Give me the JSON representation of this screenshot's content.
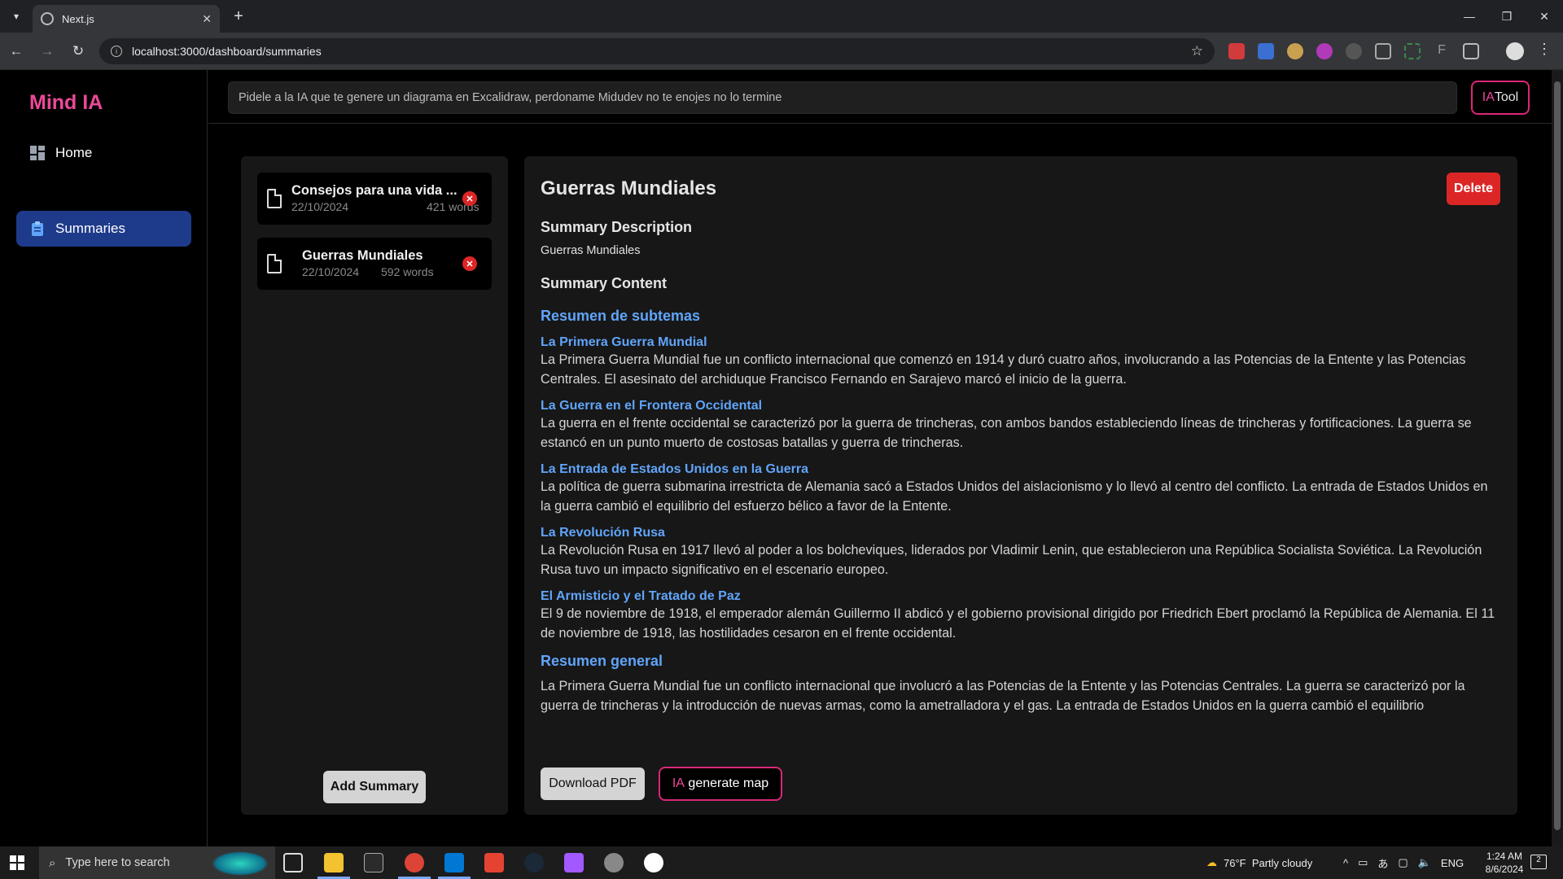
{
  "browser": {
    "tab_title": "Next.js",
    "url": "localhost:3000/dashboard/summaries"
  },
  "app": {
    "brand": "Mind IA",
    "nav": [
      {
        "label": "Home",
        "icon": "dashboard-icon"
      },
      {
        "label": "Summaries",
        "icon": "clipboard-icon",
        "active": true
      }
    ],
    "prompt_placeholder": "Pidele a la IA que te genere un diagrama en Excalidraw, perdoname Midudev no te enojes no lo termine",
    "iatool": {
      "prefix": "IA",
      "label": "Tool"
    }
  },
  "summaries": [
    {
      "title": "Consejos para una vida ...",
      "date": "22/10/2024",
      "words": "421 words"
    },
    {
      "title": "Guerras Mundiales",
      "date": "22/10/2024",
      "words": "592 words"
    }
  ],
  "add_summary_label": "Add Summary",
  "detail": {
    "title": "Guerras Mundiales",
    "delete_label": "Delete",
    "description_heading": "Summary Description",
    "description": "Guerras Mundiales",
    "content_heading": "Summary Content",
    "subtopics_heading": "Resumen de subtemas",
    "sections": [
      {
        "title": "La Primera Guerra Mundial",
        "text": "La Primera Guerra Mundial fue un conflicto internacional que comenzó en 1914 y duró cuatro años, involucrando a las Potencias de la Entente y las Potencias Centrales. El asesinato del archiduque Francisco Fernando en Sarajevo marcó el inicio de la guerra."
      },
      {
        "title": "La Guerra en el Frontera Occidental",
        "text": "La guerra en el frente occidental se caracterizó por la guerra de trincheras, con ambos bandos estableciendo líneas de trincheras y fortificaciones. La guerra se estancó en un punto muerto de costosas batallas y guerra de trincheras."
      },
      {
        "title": "La Entrada de Estados Unidos en la Guerra",
        "text": "La política de guerra submarina irrestricta de Alemania sacó a Estados Unidos del aislacionismo y lo llevó al centro del conflicto. La entrada de Estados Unidos en la guerra cambió el equilibrio del esfuerzo bélico a favor de la Entente."
      },
      {
        "title": "La Revolución Rusa",
        "text": "La Revolución Rusa en 1917 llevó al poder a los bolcheviques, liderados por Vladimir Lenin, que establecieron una República Socialista Soviética. La Revolución Rusa tuvo un impacto significativo en el escenario europeo."
      },
      {
        "title": "El Armisticio y el Tratado de Paz",
        "text": "El 9 de noviembre de 1918, el emperador alemán Guillermo II abdicó y el gobierno provisional dirigido por Friedrich Ebert proclamó la República de Alemania. El 11 de noviembre de 1918, las hostilidades cesaron en el frente occidental."
      }
    ],
    "general_heading": "Resumen general",
    "general_text": "La Primera Guerra Mundial fue un conflicto internacional que involucró a las Potencias de la Entente y las Potencias Centrales. La guerra se caracterizó por la guerra de trincheras y la introducción de nuevas armas, como la ametralladora y el gas. La entrada de Estados Unidos en la guerra cambió el equilibrio",
    "download_label": "Download PDF",
    "map_prefix": "IA",
    "map_label": " generate map"
  },
  "taskbar": {
    "search_placeholder": "Type here to search",
    "weather": "76°F  Partly cloudy",
    "language": "ENG",
    "time": "1:24 AM",
    "date": "8/6/2024",
    "notification_count": "2"
  },
  "colors": {
    "brand": "#ec4899",
    "active_nav": "#1e3a8a",
    "link": "#60a5fa",
    "danger": "#dc2626"
  }
}
